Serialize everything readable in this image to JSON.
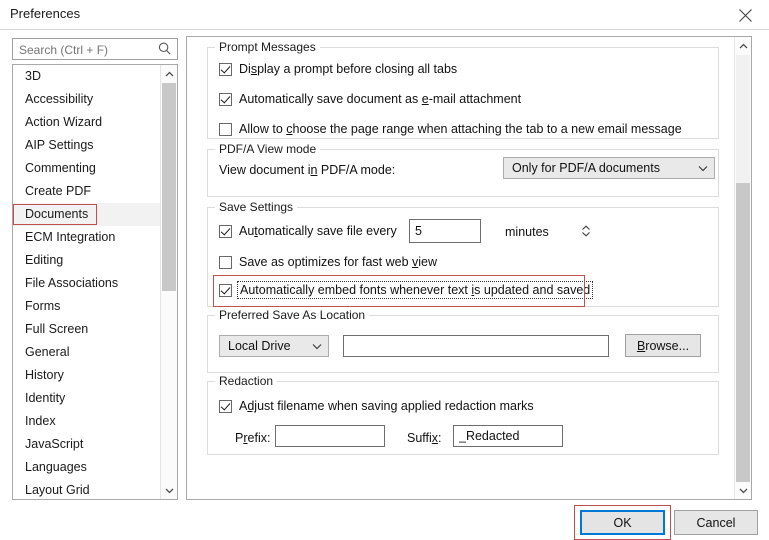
{
  "window": {
    "title": "Preferences",
    "close_icon": "close-icon"
  },
  "search": {
    "placeholder": "Search (Ctrl + F)",
    "value": "",
    "icon": "search-icon"
  },
  "sidebar": {
    "selected": "Documents",
    "items": [
      {
        "label": "3D"
      },
      {
        "label": "Accessibility"
      },
      {
        "label": "Action Wizard"
      },
      {
        "label": "AIP Settings"
      },
      {
        "label": "Commenting"
      },
      {
        "label": "Create PDF"
      },
      {
        "label": "Documents"
      },
      {
        "label": "ECM Integration"
      },
      {
        "label": "Editing"
      },
      {
        "label": "File Associations"
      },
      {
        "label": "Forms"
      },
      {
        "label": "Full Screen"
      },
      {
        "label": "General"
      },
      {
        "label": "History"
      },
      {
        "label": "Identity"
      },
      {
        "label": "Index"
      },
      {
        "label": "JavaScript"
      },
      {
        "label": "Languages"
      },
      {
        "label": "Layout Grid"
      }
    ]
  },
  "groups": {
    "prompt_messages": {
      "title": "Prompt Messages",
      "checkboxes": [
        {
          "label_pre": "Di",
          "accel": "s",
          "label_post": "play a prompt before closing all tabs",
          "checked": true
        },
        {
          "label_pre": "Automatically save document as ",
          "accel": "e",
          "label_post": "-mail attachment",
          "checked": true
        },
        {
          "label_pre": "Allow to ",
          "accel": "c",
          "label_post": "hoose the page range when attaching the tab to a new email message",
          "checked": false
        }
      ]
    },
    "pdfa_view_mode": {
      "title": "PDF/A View mode",
      "label_pre": "View document i",
      "accel": "n",
      "label_post": " PDF/A mode:",
      "dropdown_value": "Only for PDF/A documents"
    },
    "save_settings": {
      "title": "Save Settings",
      "autosave": {
        "label_pre": "Au",
        "accel": "t",
        "label_post": "omatically save file every",
        "checked": true
      },
      "autosave_minutes": "5",
      "minutes_label": "minutes",
      "fast_web_view": {
        "label_pre": "Save as optimizes for fast web ",
        "accel": "v",
        "label_post": "iew",
        "checked": false
      },
      "embed_fonts": {
        "label_pre": "Automatically embed fonts whenever text ",
        "accel": "i",
        "label_post": "s updated and saved",
        "checked": true,
        "focused": true,
        "annotated": true
      }
    },
    "preferred_save_location": {
      "title": "Preferred Save As Location",
      "dropdown_value": "Local Drive",
      "path_value": "",
      "browse_pre": "",
      "browse_accel": "B",
      "browse_post": "rowse..."
    },
    "redaction": {
      "title": "Redaction",
      "adjust_filename": {
        "label_pre": "A",
        "accel": "dj",
        "label_post": "ust filename when saving applied redaction marks",
        "checked": true
      },
      "prefix_label_pre": "P",
      "prefix_accel": "r",
      "prefix_label_post": "efix:",
      "prefix_value": "",
      "suffix_label_pre": "Suffi",
      "suffix_accel": "x",
      "suffix_label_post": ":",
      "suffix_value": "_Redacted"
    }
  },
  "footer": {
    "ok_label": "OK",
    "cancel_label": "Cancel",
    "ok_default": true,
    "ok_annotated": true
  },
  "colors": {
    "annotation": "#c0504d",
    "focus_blue": "#0078d7",
    "selection_bg": "#f2f2f2"
  }
}
